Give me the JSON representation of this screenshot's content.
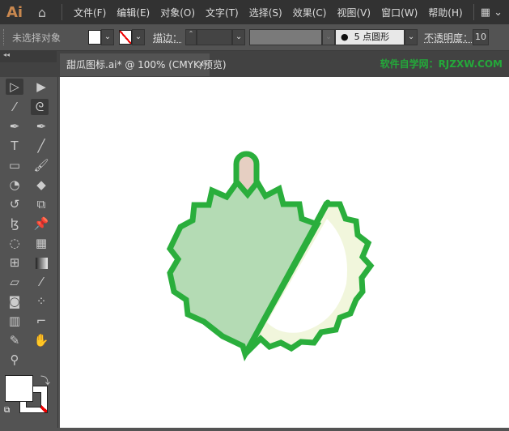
{
  "app": {
    "logo": "Ai"
  },
  "menu": [
    "文件(F)",
    "编辑(E)",
    "对象(O)",
    "文字(T)",
    "选择(S)",
    "效果(C)",
    "视图(V)",
    "窗口(W)",
    "帮助(H)"
  ],
  "control": {
    "selection": "未选择对象",
    "stroke_label": "描边：",
    "brush": "5 点圆形",
    "opacity_label": "不透明度：",
    "opacity_value": "10"
  },
  "document": {
    "tab_title": "甜瓜图标.ai* @ 100% (CMYK/预览)",
    "close": "×"
  },
  "watermark": "软件自学网：RJZXW.COM",
  "colors": {
    "stroke": "#2aae3c",
    "rind": "#b4dbb4",
    "flesh": "#f1f6dc",
    "stem": "#e6cfc2"
  },
  "tools": [
    "selection",
    "direct-selection",
    "magic-wand",
    "lasso",
    "pen",
    "curvature",
    "type",
    "line",
    "rectangle",
    "paintbrush",
    "shaper",
    "eraser",
    "rotate",
    "scale",
    "puppet-warp",
    "pin",
    "shape-builder",
    "perspective-grid",
    "mesh",
    "gradient",
    "measure",
    "eyedropper",
    "blend",
    "symbol-sprayer",
    "graph",
    "artboard",
    "slice",
    "hand",
    "zoom"
  ]
}
